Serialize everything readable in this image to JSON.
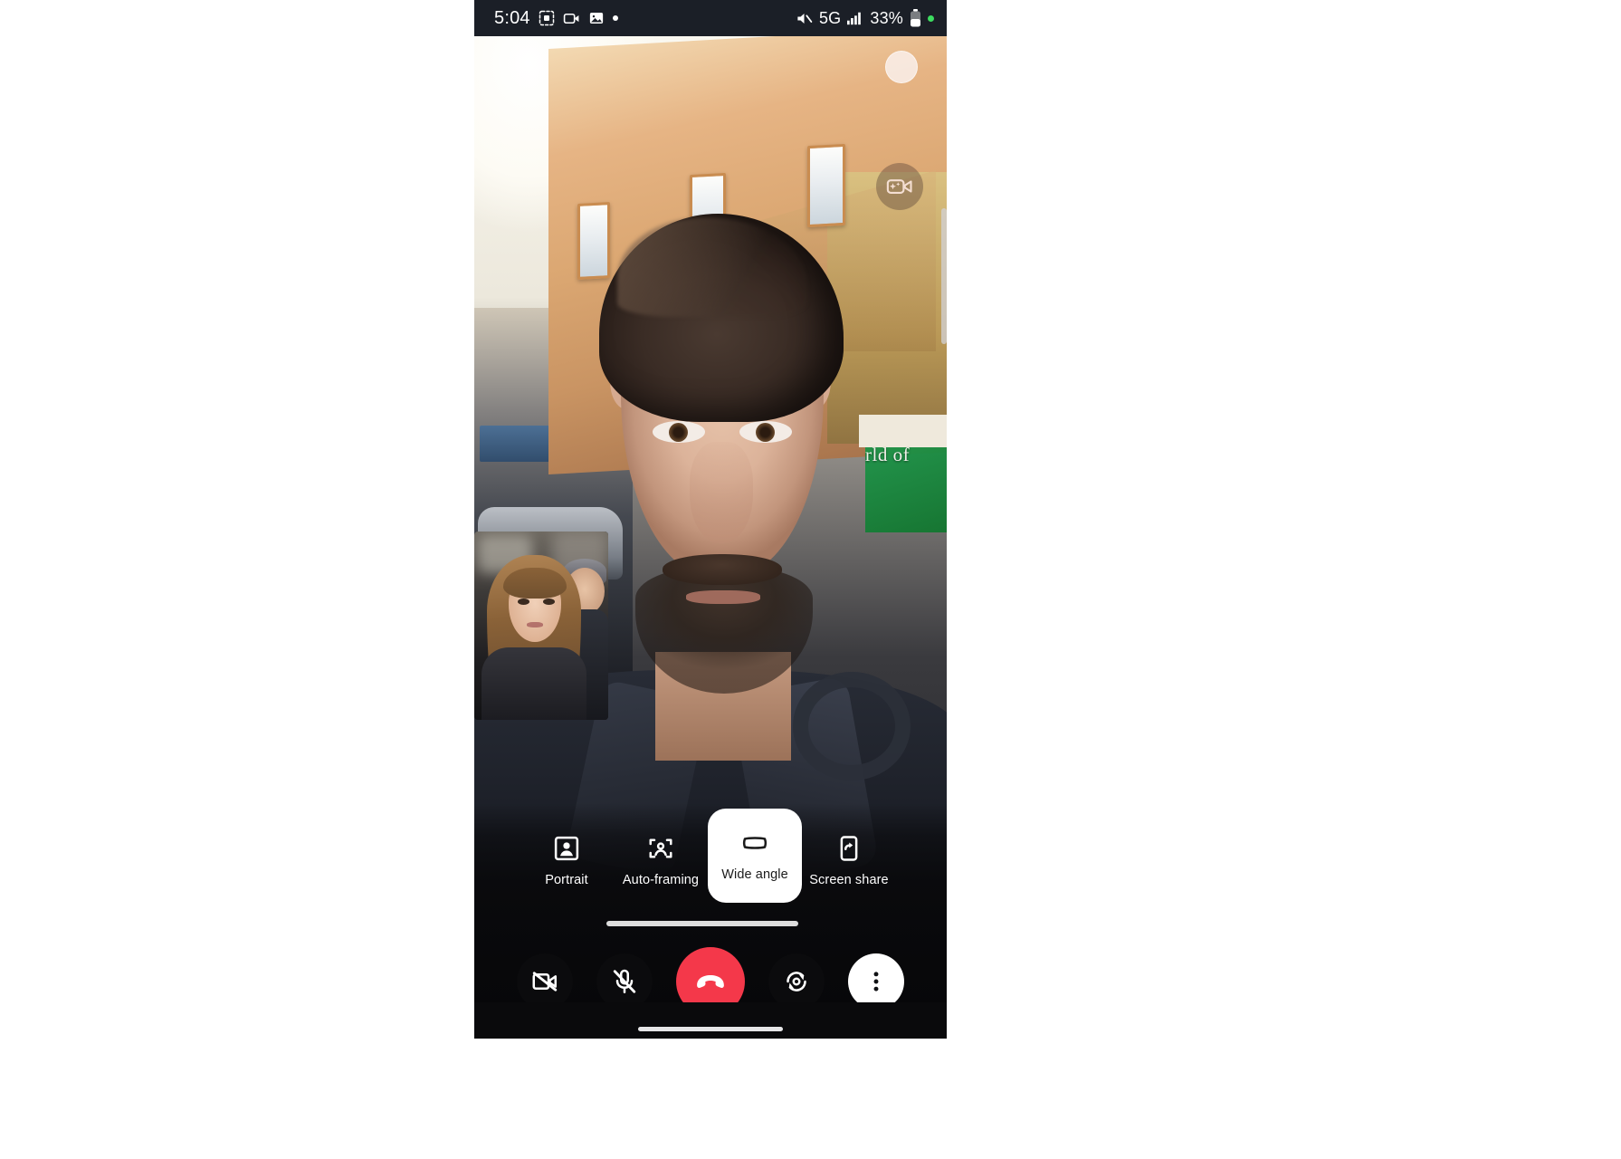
{
  "status_bar": {
    "time": "5:04",
    "left_icons": [
      "screenshot-icon",
      "video-recorder-icon",
      "image-icon",
      "dot-indicator-icon"
    ],
    "right_icons": [
      "volume-muted-icon",
      "signal-bars-icon",
      "battery-icon",
      "green-dot-icon"
    ],
    "network": "5G",
    "battery_percent": "33%"
  },
  "video_call": {
    "scene_sign_text": "rld of",
    "top_right_button": "camera-shutter-circle",
    "effects_button": "video-effects-icon",
    "self_view_label": "self-view-thumbnail"
  },
  "effects_bar": {
    "items": [
      {
        "id": "portrait",
        "label": "Portrait",
        "icon": "portrait-icon",
        "selected": false
      },
      {
        "id": "autoframing",
        "label": "Auto-framing",
        "icon": "autoframe-icon",
        "selected": false
      },
      {
        "id": "wideangle",
        "label": "Wide angle",
        "icon": "wide-angle-icon",
        "selected": true
      },
      {
        "id": "screenshare",
        "label": "Screen share",
        "icon": "screen-share-icon",
        "selected": false
      }
    ]
  },
  "call_controls": [
    {
      "id": "camera",
      "label": "Turn off camera",
      "icon": "video-off-icon",
      "style": "dark"
    },
    {
      "id": "mic",
      "label": "Mute microphone",
      "icon": "mic-off-icon",
      "style": "dark"
    },
    {
      "id": "end",
      "label": "End call",
      "icon": "end-call-icon",
      "style": "end"
    },
    {
      "id": "flip",
      "label": "Flip camera",
      "icon": "flip-camera-icon",
      "style": "dark"
    },
    {
      "id": "more",
      "label": "More options",
      "icon": "more-vertical-icon",
      "style": "light"
    }
  ],
  "colors": {
    "end_call": "#f4384a",
    "selected_chip": "#ffffff",
    "status_bar_bg": "#1b1f27",
    "battery_green": "#3ddc60"
  }
}
